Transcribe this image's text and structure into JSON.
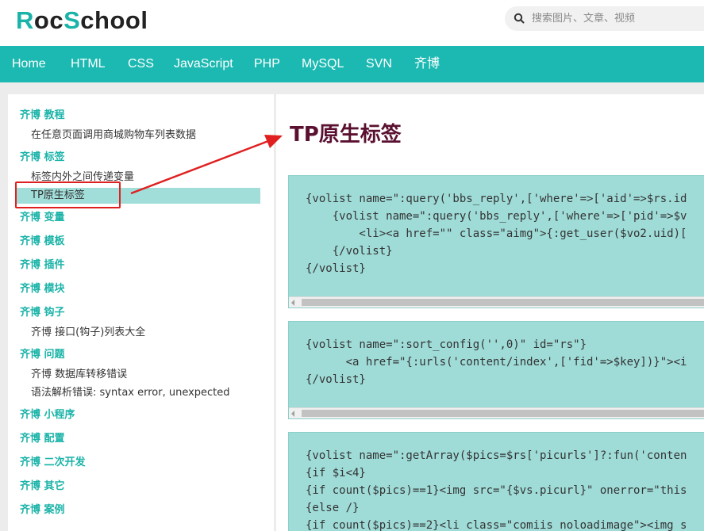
{
  "header": {
    "logo_prefix": "R",
    "logo_mid1": "oc",
    "logo_s": "S",
    "logo_rest": "chool",
    "search_placeholder": "搜索图片、文章、视频"
  },
  "nav": {
    "items": [
      "Home",
      "HTML",
      "CSS",
      "JavaScript",
      "PHP",
      "MySQL",
      "SVN",
      "齐博"
    ]
  },
  "sidebar": {
    "items": [
      {
        "type": "category",
        "label": "齐博 教程"
      },
      {
        "type": "item",
        "label": "在任意页面调用商城购物车列表数据"
      },
      {
        "type": "category",
        "label": "齐博 标签"
      },
      {
        "type": "item",
        "label": "标签内外之间传递变量"
      },
      {
        "type": "item",
        "label": "TP原生标签",
        "active": true
      },
      {
        "type": "category",
        "label": "齐博 变量"
      },
      {
        "type": "category",
        "label": "齐博 模板"
      },
      {
        "type": "category",
        "label": "齐博 插件"
      },
      {
        "type": "category",
        "label": "齐博 模块"
      },
      {
        "type": "category",
        "label": "齐博 钩子"
      },
      {
        "type": "item",
        "label": "齐博 接口(钩子)列表大全"
      },
      {
        "type": "category",
        "label": "齐博 问题"
      },
      {
        "type": "item",
        "label": "齐博 数据库转移错误"
      },
      {
        "type": "item",
        "label": "语法解析错误: syntax error, unexpected"
      },
      {
        "type": "category",
        "label": "齐博 小程序"
      },
      {
        "type": "category",
        "label": "齐博 配置"
      },
      {
        "type": "category",
        "label": "齐博 二次开发"
      },
      {
        "type": "category",
        "label": "齐博 其它"
      },
      {
        "type": "category",
        "label": "齐博 案例"
      }
    ]
  },
  "main": {
    "title": "TP原生标签",
    "code_blocks": [
      "{volist name=\":query('bbs_reply',['where'=>['aid'=>$rs.id\n    {volist name=\":query('bbs_reply',['where'=>['pid'=>$v\n        <li><a href=\"\" class=\"aimg\">{:get_user($vo2.uid)[\n    {/volist}\n{/volist}",
      "{volist name=\":sort_config('',0)\" id=\"rs\"}\n      <a href=\"{:urls('content/index',['fid'=>$key])}\"><i\n{/volist}",
      "{volist name=\":getArray($pics=$rs['picurls']?:fun('conten\n{if $i<4}\n{if count($pics)==1}<img src=\"{$vs.picurl}\" onerror=\"this\n{else /}\n{if count($pics)==2}<li class=\"comiis_noloadimage\"><img s"
    ]
  },
  "colors": {
    "accent": "#1ab3a8",
    "nav_bg": "#1bb9b1",
    "code_bg": "#9fdcd8",
    "title": "#5a1030",
    "annotation": "#e02020"
  }
}
